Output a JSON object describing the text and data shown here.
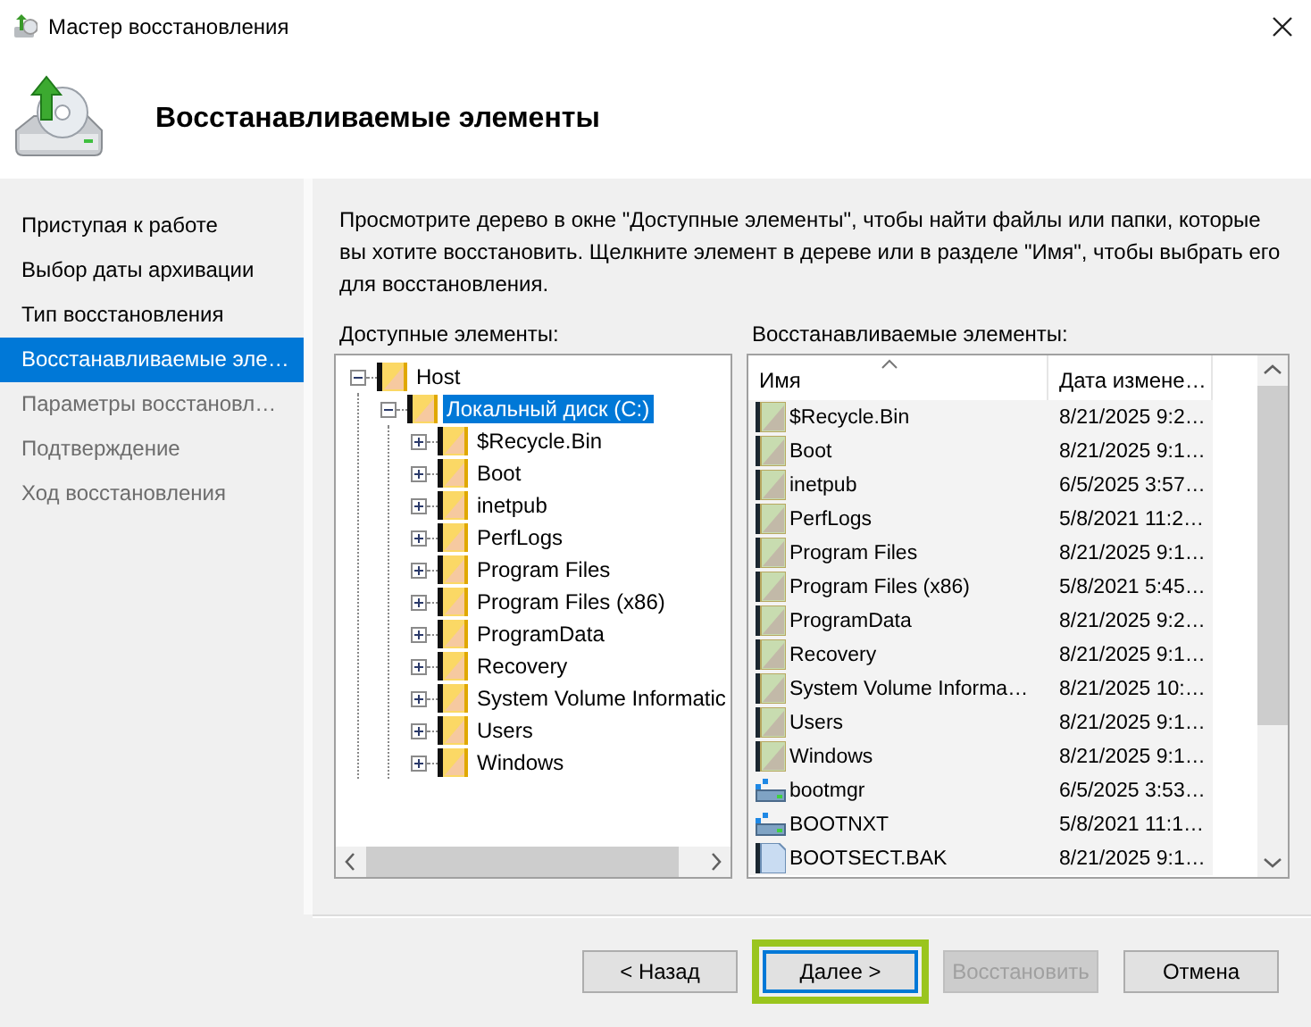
{
  "window": {
    "title": "Мастер восстановления"
  },
  "header": {
    "title": "Восстанавливаемые элементы"
  },
  "steps": [
    {
      "label": "Приступая к работе",
      "selected": false,
      "disabled": false
    },
    {
      "label": "Выбор даты архивации",
      "selected": false,
      "disabled": false
    },
    {
      "label": "Тип восстановления",
      "selected": false,
      "disabled": false
    },
    {
      "label": "Восстанавливаемые эле…",
      "selected": true,
      "disabled": false
    },
    {
      "label": "Параметры восстановл…",
      "selected": false,
      "disabled": true
    },
    {
      "label": "Подтверждение",
      "selected": false,
      "disabled": true
    },
    {
      "label": "Ход восстановления",
      "selected": false,
      "disabled": true
    }
  ],
  "instructions": "Просмотрите дерево в окне \"Доступные элементы\", чтобы найти файлы или папки, которые вы хотите восстановить. Щелкните элемент в дереве или в разделе \"Имя\", чтобы выбрать его для восстановления.",
  "tree": {
    "label": "Доступные элементы:",
    "items": [
      {
        "name": "Host",
        "expanded": true,
        "selected": false,
        "children": [
          {
            "name": "Локальный диск (C:)",
            "expanded": true,
            "selected": true,
            "children": [
              {
                "name": "$Recycle.Bin",
                "expanded": false,
                "selected": false
              },
              {
                "name": "Boot",
                "expanded": false,
                "selected": false
              },
              {
                "name": "inetpub",
                "expanded": false,
                "selected": false
              },
              {
                "name": "PerfLogs",
                "expanded": false,
                "selected": false
              },
              {
                "name": "Program Files",
                "expanded": false,
                "selected": false
              },
              {
                "name": "Program Files (x86)",
                "expanded": false,
                "selected": false
              },
              {
                "name": "ProgramData",
                "expanded": false,
                "selected": false
              },
              {
                "name": "Recovery",
                "expanded": false,
                "selected": false
              },
              {
                "name": "System Volume Informatic",
                "expanded": false,
                "selected": false
              },
              {
                "name": "Users",
                "expanded": false,
                "selected": false
              },
              {
                "name": "Windows",
                "expanded": false,
                "selected": false
              }
            ]
          }
        ]
      }
    ]
  },
  "list": {
    "label": "Восстанавливаемые элементы:",
    "columns": [
      {
        "label": "Имя",
        "sorted": true
      },
      {
        "label": "Дата измене…",
        "sorted": false
      }
    ],
    "rows": [
      {
        "kind": "folder",
        "name": "$Recycle.Bin",
        "date": "8/21/2025 9:2…"
      },
      {
        "kind": "folder",
        "name": "Boot",
        "date": "8/21/2025 9:1…"
      },
      {
        "kind": "folder",
        "name": "inetpub",
        "date": "6/5/2025 3:57…"
      },
      {
        "kind": "folder",
        "name": "PerfLogs",
        "date": "5/8/2021 11:2…"
      },
      {
        "kind": "folder",
        "name": "Program Files",
        "date": "8/21/2025 9:1…"
      },
      {
        "kind": "folder",
        "name": "Program Files (x86)",
        "date": "5/8/2021 5:45…"
      },
      {
        "kind": "folder",
        "name": "ProgramData",
        "date": "8/21/2025 9:2…"
      },
      {
        "kind": "folder",
        "name": "Recovery",
        "date": "8/21/2025 9:1…"
      },
      {
        "kind": "folder",
        "name": "System Volume Informa…",
        "date": "8/21/2025 10:…"
      },
      {
        "kind": "folder",
        "name": "Users",
        "date": "8/21/2025 9:1…"
      },
      {
        "kind": "folder",
        "name": "Windows",
        "date": "8/21/2025 9:1…"
      },
      {
        "kind": "system",
        "name": "bootmgr",
        "date": "6/5/2025 3:53…"
      },
      {
        "kind": "system",
        "name": "BOOTNXT",
        "date": "5/8/2021 11:1…"
      },
      {
        "kind": "file",
        "name": "BOOTSECT.BAK",
        "date": "8/21/2025 9:1…"
      }
    ]
  },
  "buttons": [
    {
      "label": "< Назад",
      "disabled": false,
      "default": false,
      "highlighted": false
    },
    {
      "label": "Далее >",
      "disabled": false,
      "default": true,
      "highlighted": true
    },
    {
      "label": "Восстановить",
      "disabled": true,
      "default": false,
      "highlighted": false
    },
    {
      "label": "Отмена",
      "disabled": false,
      "default": false,
      "highlighted": false
    }
  ]
}
